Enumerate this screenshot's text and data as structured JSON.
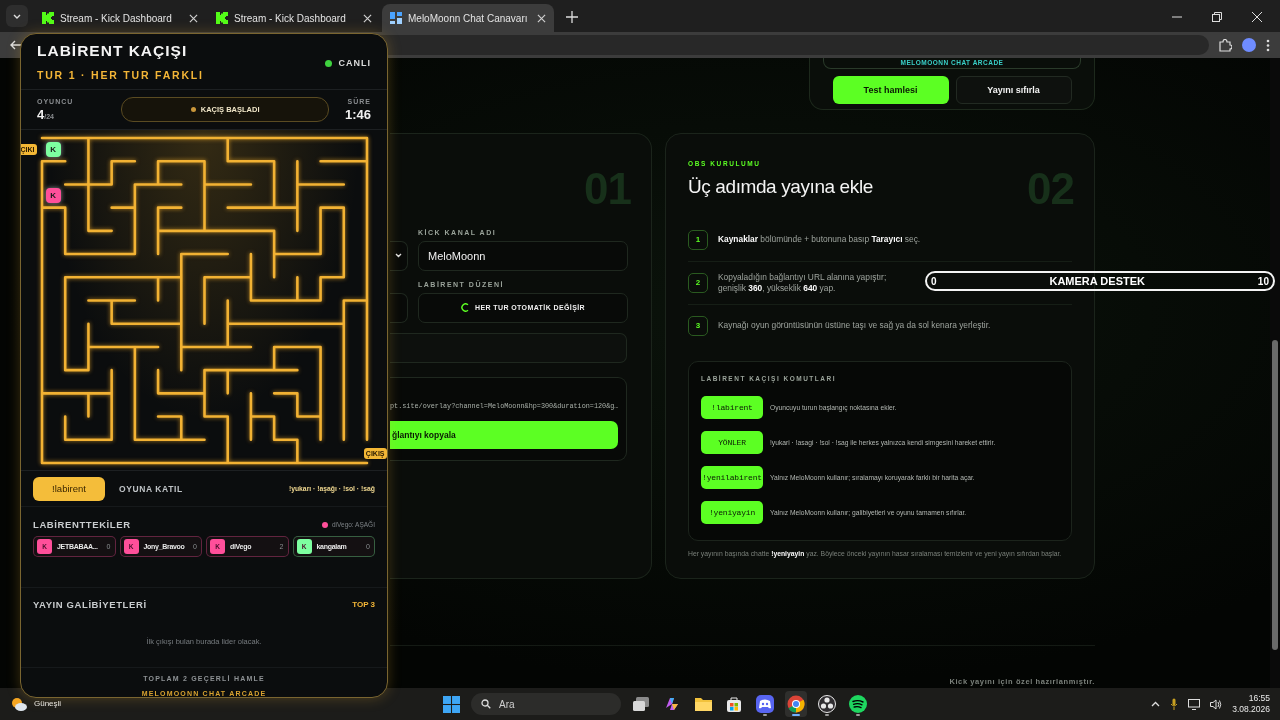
{
  "browser": {
    "tabs": [
      {
        "title": "Stream - Kick Dashboard",
        "kind": "kick",
        "selected": false
      },
      {
        "title": "Stream - Kick Dashboard",
        "kind": "kick",
        "selected": false
      },
      {
        "title": "MeloMoonn Chat Canavarı",
        "kind": "app",
        "selected": true
      }
    ]
  },
  "top_panel": {
    "banner": "MELOMOONN CHAT ARCADE",
    "buttons": [
      {
        "label": "Test hamlesi",
        "kind": "primary"
      },
      {
        "label": "Yayını sıfırla",
        "kind": "secondary"
      }
    ]
  },
  "setup_card": {
    "number": "01",
    "channel_label": "KİCK KANAL ADI",
    "channel_value": "MeloMoonn",
    "layout_label": "LABİRENT DÜZENİ",
    "layout_value": "HER TUR OTOMATİK DEĞİŞİR",
    "overlay_url": "pt.site/overlay?channel=MeloMoonn&hp=300&duration=120&g…",
    "copy_button": "ğlantıyı kopyala"
  },
  "obs_card": {
    "eyebrow": "OBS KURULUMU",
    "title": "Üç adımda yayına ekle",
    "number": "02",
    "steps": [
      {
        "number": "1",
        "text": "**Kaynaklar** bölümünde + butonuna basıp **Tarayıcı** seç."
      },
      {
        "number": "2",
        "text": "Kopyaladığın bağlantıyı URL alanına yapıştır; genişlik **360**, yükseklik **640** yap."
      },
      {
        "number": "3",
        "text": "Kaynağı oyun görüntüsünün üstüne taşı ve sağ ya da sol kenara yerleştir."
      }
    ],
    "commands_title": "LABİRENT KAÇIŞI KOMUTLARI",
    "commands": [
      {
        "command": "!labirent",
        "text": "Oyuncuyu turun başlangıç noktasına ekler."
      },
      {
        "command": "YÖNLER",
        "text": "!yukari · !asagi · !sol · !sag ile herkes yalnızca kendi simgesini hareket ettirir."
      },
      {
        "command": "!yenilabirent",
        "text": "Yalnız MeloMoonn kullanır; sıralamayı koruyarak farklı bir harita açar."
      },
      {
        "command": "!yeniyayin",
        "text": "Yalnız MeloMoonn kullanır; galibiyetleri ve oyunu tamamen sıfırlar."
      }
    ],
    "note": "Her yayının başında chatte **!yeniyayin** yaz. Böylece önceki yayının hasar sıralaması temizlenir ve yeni yayın sıfırdan başlar."
  },
  "footer": "Kick yayını için özel hazırlanmıştır.",
  "camera_bar": {
    "min": "0",
    "label": "KAMERA DESTEK",
    "max": "10"
  },
  "overlay": {
    "title": "LABİRENT KAÇIŞI",
    "subtitle": "TUR 1 · HER TUR FARKLI",
    "live": "CANLI",
    "players_label": "OYUNCU",
    "players_count": "4",
    "players_max": "/24",
    "status": "KAÇIŞ BAŞLADI",
    "time_label": "SÜRE",
    "time": "1:46",
    "maze": {
      "start_tag": "ÇIKI",
      "exit_tag": "ÇIKIŞ",
      "tokens": [
        {
          "letter": "K",
          "color": "#7dffa0"
        },
        {
          "letter": "K",
          "color": "#ff4f9a"
        }
      ]
    },
    "join": {
      "command": "!labirent",
      "label": "OYUNA KATIL",
      "hint": "!yukarı · !aşağı · !sol · !sağ"
    },
    "players_title": "LABİRENTTEKİLER",
    "last_move": {
      "text": "diVego: AŞAĞI",
      "color": "#ff4f9a"
    },
    "players": [
      {
        "badge": "K",
        "name": "JETBABAA...",
        "score": "0",
        "color": "#ff4f9a"
      },
      {
        "badge": "K",
        "name": "Jony_Bravoo",
        "score": "0",
        "color": "#ff4f9a"
      },
      {
        "badge": "K",
        "name": "diVego",
        "score": "2",
        "color": "#ff4f9a"
      },
      {
        "badge": "K",
        "name": "kangalam",
        "score": "0",
        "color": "#7dffa0"
      }
    ],
    "winners_title": "YAYIN GALİBİYETLERİ",
    "winners_badge": "TOP 3",
    "winners_empty": "İlk çıkışı bulan burada lider olacak.",
    "total": "TOPLAM 2 GEÇERLİ HAMLE",
    "brand": "MELOMOONN CHAT ARCADE"
  },
  "taskbar": {
    "weather": {
      "condition": "Güneşli"
    },
    "search": "Ara",
    "apps": [
      {
        "kind": "start",
        "selected": false,
        "running": false
      },
      {
        "kind": "taskview",
        "selected": false,
        "running": false
      },
      {
        "kind": "copilot",
        "selected": false,
        "running": false
      },
      {
        "kind": "folder",
        "selected": false,
        "running": false
      },
      {
        "kind": "store",
        "selected": false,
        "running": false
      },
      {
        "kind": "gamepad",
        "selected": false,
        "running": true
      },
      {
        "kind": "browser",
        "selected": true,
        "running": true
      },
      {
        "kind": "aperture",
        "selected": false,
        "running": true
      },
      {
        "kind": "music",
        "selected": false,
        "running": true
      }
    ],
    "clock": {
      "time": "16:55",
      "date": "3.08.2026"
    }
  }
}
